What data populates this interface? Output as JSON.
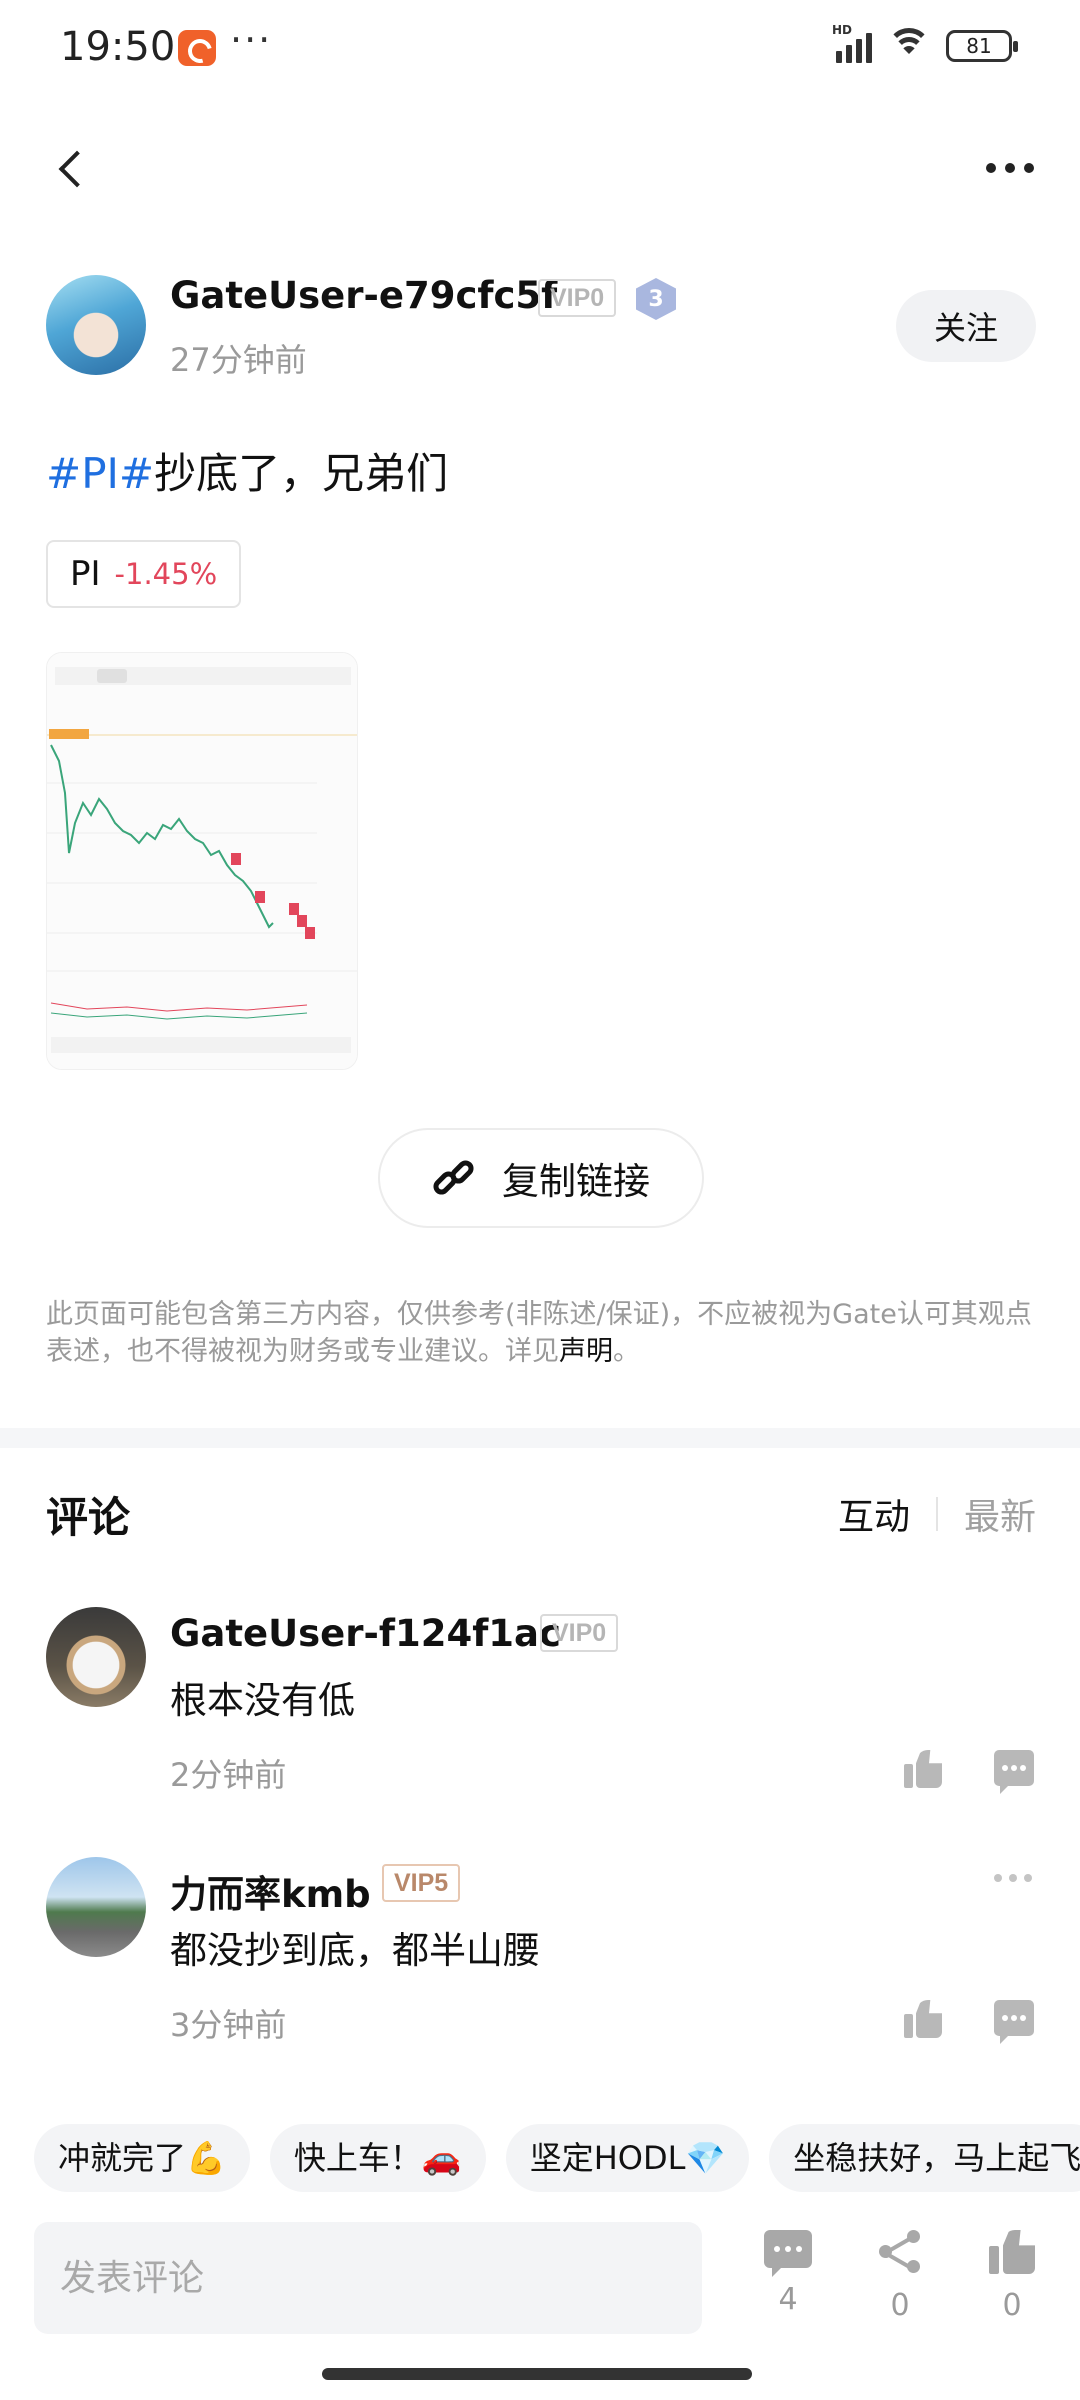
{
  "status_bar": {
    "time": "19:50",
    "more": "···",
    "network": "HD",
    "battery": "81"
  },
  "post": {
    "author": "GateUser-e79cfc5f",
    "vip": "VIP0",
    "level": "3",
    "time_ago": "27分钟前",
    "follow_label": "关注",
    "tag": "#PI#",
    "text": "抄底了，兄弟们",
    "coin": {
      "symbol": "PI",
      "change": "-1.45%"
    },
    "copy_link_label": "复制链接",
    "disclaimer": "此页面可能包含第三方内容，仅供参考(非陈述/保证)，不应被视为Gate认可其观点表述，也不得被视为财务或专业建议。详见",
    "disclaimer_link": "声明",
    "disclaimer_end": "。"
  },
  "comments_section": {
    "title": "评论",
    "sort_tabs": [
      "互动",
      "最新"
    ],
    "comments": [
      {
        "author": "GateUser-f124f1ac",
        "vip": "VIP0",
        "text": "根本没有低",
        "time_ago": "2分钟前"
      },
      {
        "author": "力而率kmb",
        "vip": "VIP5",
        "text": "都没抄到底，都半山腰",
        "time_ago": "3分钟前"
      }
    ]
  },
  "quick_replies": [
    "冲就完了💪",
    "快上车！🚗",
    "坚定HODL💎",
    "坐稳扶好，马上起飞"
  ],
  "bottom_bar": {
    "input_placeholder": "发表评论",
    "comment_count": "4",
    "share_count": "0",
    "like_count": "0"
  },
  "colors": {
    "tag_blue": "#1f6fe0",
    "negative_red": "#e2465b",
    "muted_gray": "#9a9a9a"
  },
  "icons": [
    "back-icon",
    "more-icon",
    "link-icon",
    "like-icon",
    "reply-icon",
    "comment-icon",
    "share-icon"
  ]
}
